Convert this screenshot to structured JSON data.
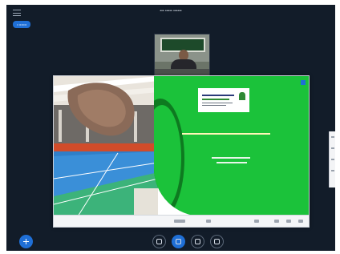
{
  "header": {
    "meeting_title": "••• ••••• ••••••",
    "recording_badge": "• •••••••"
  },
  "icons": {
    "menu": "menu-icon",
    "webcam": "webcam-video",
    "plus": "plus-icon",
    "audio": "audio-icon",
    "mic": "microphone-icon",
    "camera": "camera-icon",
    "screen_share": "screen-share-icon"
  },
  "colors": {
    "background": "#121c29",
    "accent": "#1f6fd6",
    "slide_green": "#1bc23a"
  }
}
